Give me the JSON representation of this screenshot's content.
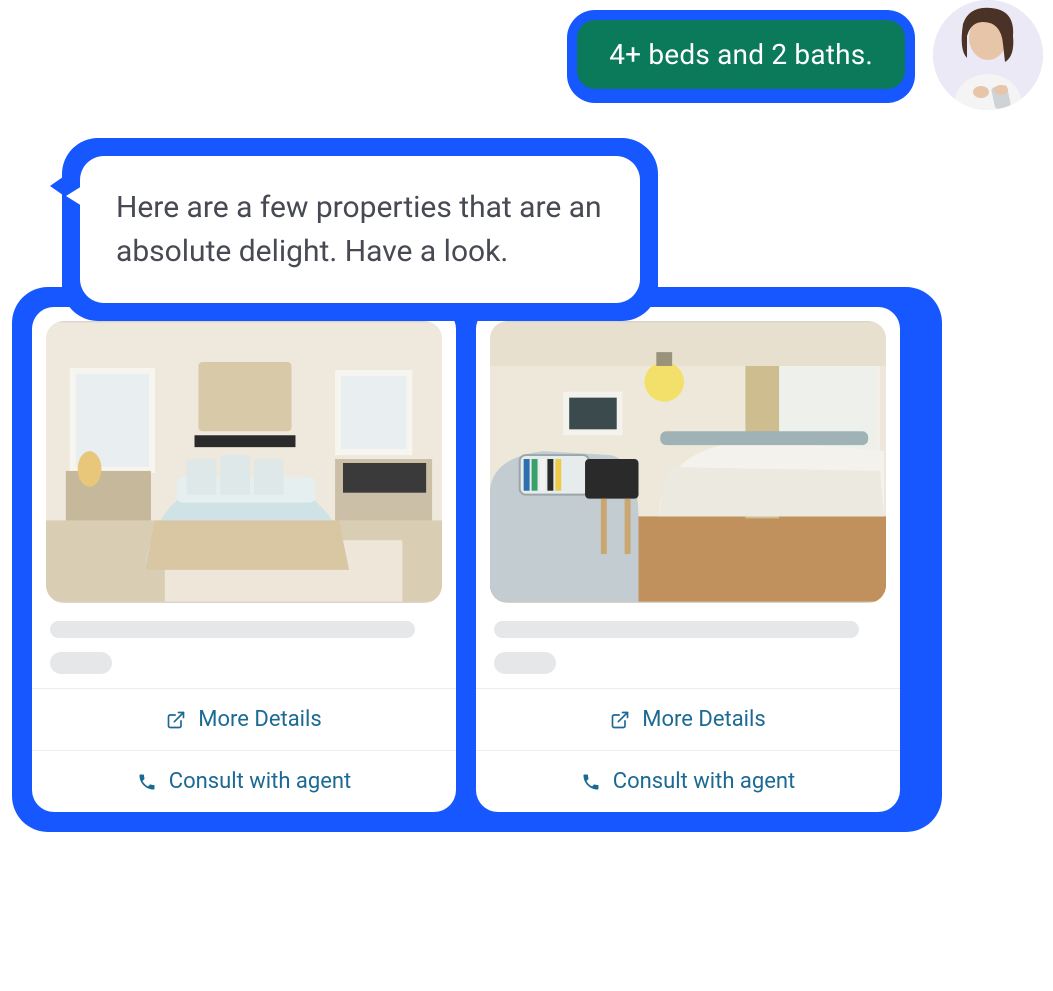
{
  "user": {
    "message": "4+ beds and 2 baths."
  },
  "bot": {
    "message": "Here are a few properties that are an absolute delight. Have a look."
  },
  "cards": [
    {
      "more_details_label": "More Details",
      "consult_label": "Consult with agent"
    },
    {
      "more_details_label": "More Details",
      "consult_label": "Consult with agent"
    }
  ],
  "colors": {
    "accent_blue": "#1657ff",
    "user_bubble_green": "#0b7a5a",
    "link_teal": "#1c6a94"
  }
}
